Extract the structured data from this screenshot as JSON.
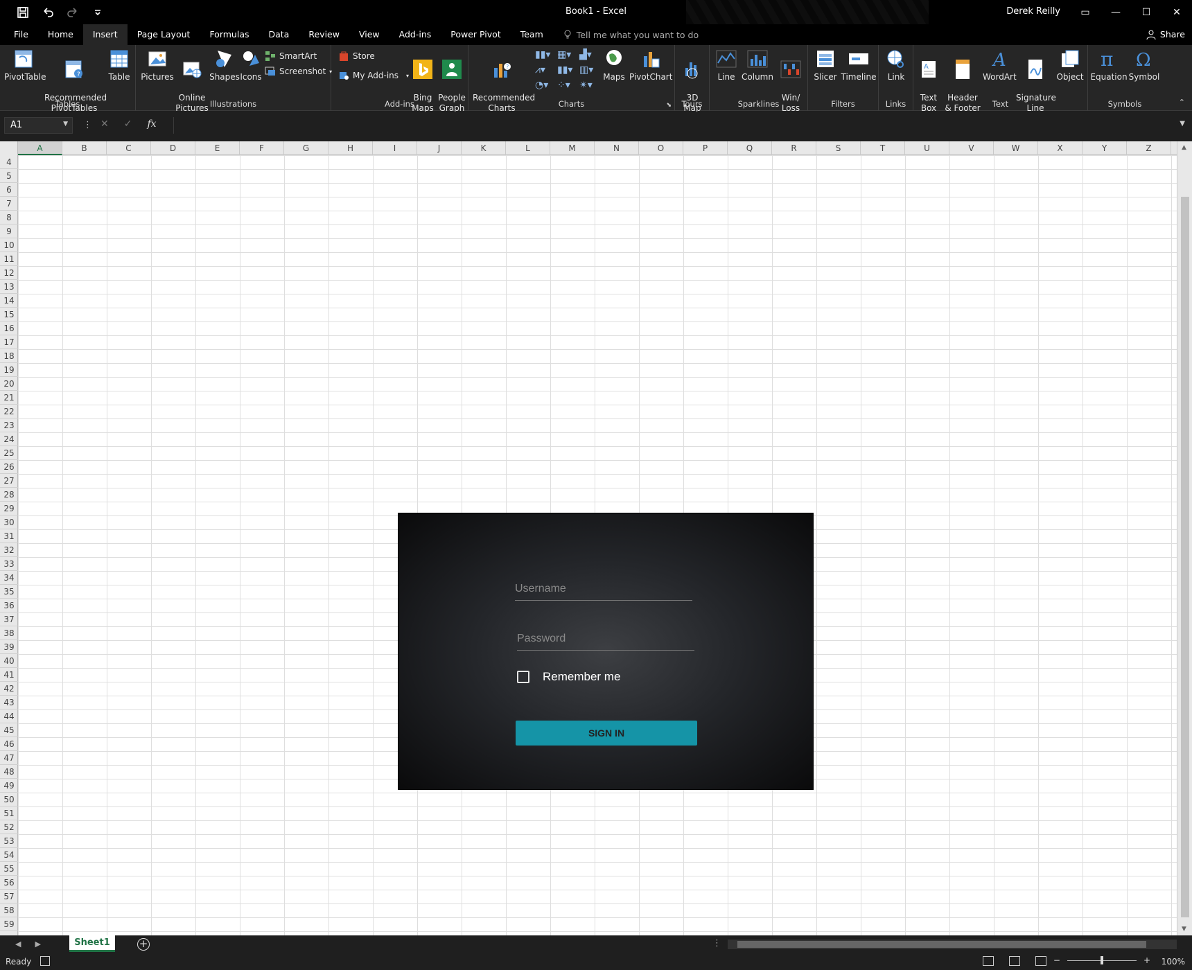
{
  "window": {
    "title": "Book1  -  Excel",
    "user": "Derek Reilly"
  },
  "tabs": [
    "File",
    "Home",
    "Insert",
    "Page Layout",
    "Formulas",
    "Data",
    "Review",
    "View",
    "Add-ins",
    "Power Pivot",
    "Team"
  ],
  "active_tab": "Insert",
  "tell_me": "Tell me what you want to do",
  "share_label": "Share",
  "ribbon": {
    "tables": {
      "label": "Tables",
      "pivottable": "PivotTable",
      "recommended_pivot": "Recommended\nPivotTables",
      "table": "Table"
    },
    "illustrations": {
      "label": "Illustrations",
      "pictures": "Pictures",
      "online_pictures": "Online\nPictures",
      "shapes": "Shapes",
      "icons": "Icons",
      "smartart": "SmartArt",
      "screenshot": "Screenshot"
    },
    "addins": {
      "label": "Add-ins",
      "store": "Store",
      "my_addins": "My Add-ins",
      "bing_maps": "Bing\nMaps",
      "people_graph": "People\nGraph"
    },
    "charts": {
      "label": "Charts",
      "recommended_charts": "Recommended\nCharts",
      "maps": "Maps",
      "pivotchart": "PivotChart"
    },
    "tours": {
      "label": "Tours",
      "map3d": "3D\nMap"
    },
    "sparklines": {
      "label": "Sparklines",
      "line": "Line",
      "column": "Column",
      "winloss": "Win/\nLoss"
    },
    "filters": {
      "label": "Filters",
      "slicer": "Slicer",
      "timeline": "Timeline"
    },
    "links": {
      "label": "Links",
      "link": "Link"
    },
    "text": {
      "label": "Text",
      "textbox": "Text\nBox",
      "header_footer": "Header\n& Footer",
      "wordart": "WordArt",
      "signature": "Signature\nLine",
      "object": "Object"
    },
    "symbols": {
      "label": "Symbols",
      "equation": "Equation",
      "symbol": "Symbol"
    }
  },
  "formula_bar": {
    "name_box": "A1",
    "fx": "fx",
    "value": ""
  },
  "columns": [
    "A",
    "B",
    "C",
    "D",
    "E",
    "F",
    "G",
    "H",
    "I",
    "J",
    "K",
    "L",
    "M",
    "N",
    "O",
    "P",
    "Q",
    "R",
    "S",
    "T",
    "U",
    "V",
    "W",
    "X",
    "Y",
    "Z"
  ],
  "rows": [
    "4",
    "5",
    "6",
    "7",
    "8",
    "9",
    "10",
    "11",
    "12",
    "13",
    "14",
    "15",
    "16",
    "17",
    "18",
    "19",
    "20",
    "21",
    "22",
    "23",
    "24",
    "25",
    "26",
    "27",
    "28",
    "29",
    "30",
    "31",
    "32",
    "33",
    "34",
    "35",
    "36",
    "37",
    "38",
    "39",
    "40",
    "41",
    "42",
    "43",
    "44",
    "45",
    "46",
    "47",
    "48",
    "49",
    "50",
    "51",
    "52",
    "53",
    "54",
    "55",
    "56",
    "57",
    "58",
    "59"
  ],
  "login": {
    "username_placeholder": "Username",
    "password_placeholder": "Password",
    "remember": "Remember me",
    "signin": "SIGN IN",
    "accent": "#1594a7"
  },
  "sheet": {
    "name": "Sheet1"
  },
  "status": {
    "ready": "Ready",
    "zoom": "100%"
  }
}
